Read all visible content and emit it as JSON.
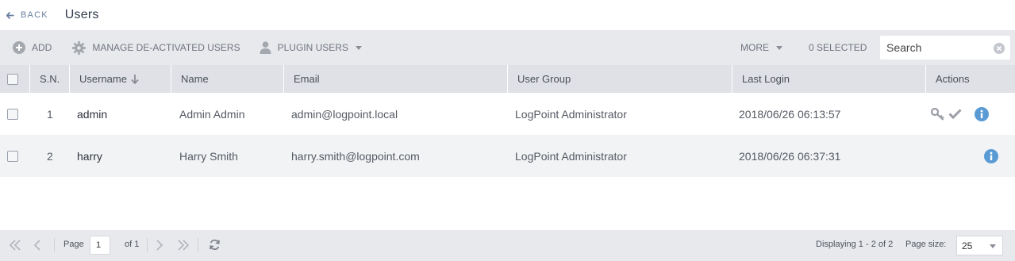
{
  "header": {
    "back_label": "BACK",
    "title": "Users"
  },
  "toolbar": {
    "add_label": "ADD",
    "manage_label": "MANAGE DE-ACTIVATED USERS",
    "plugin_label": "PLUGIN USERS",
    "more_label": "MORE",
    "selected_label": "0 SELECTED",
    "search_placeholder": "Search"
  },
  "table": {
    "columns": [
      "S.N.",
      "Username",
      "Name",
      "Email",
      "User Group",
      "Last Login",
      "Actions"
    ],
    "rows": [
      {
        "sn": "1",
        "username": "admin",
        "name": "Admin Admin",
        "email": "admin@logpoint.local",
        "group": "LogPoint Administrator",
        "last_login": "2018/06/26 06:13:57"
      },
      {
        "sn": "2",
        "username": "harry",
        "name": "Harry Smith",
        "email": "harry.smith@logpoint.com",
        "group": "LogPoint Administrator",
        "last_login": "2018/06/26 06:37:31"
      }
    ]
  },
  "footer": {
    "page_label": "Page",
    "page_value": "1",
    "of_label": "of 1",
    "displaying": "Displaying 1 - 2 of 2",
    "page_size_label": "Page size:",
    "page_size_value": "25"
  },
  "colors": {
    "accent": "#5b9bd5",
    "icon_gray": "#9a9ea6",
    "toolbar_bg": "#e8e9ed",
    "header_row_bg": "#dfe1e6"
  }
}
